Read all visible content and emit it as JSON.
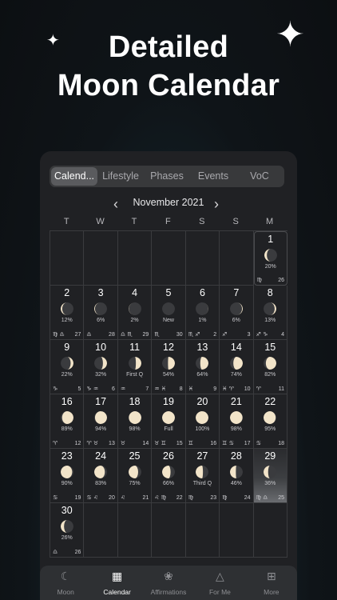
{
  "headline": {
    "line1": "Detailed",
    "line2": "Moon Calendar"
  },
  "colors": {
    "moon_lit": "#f2e4c9",
    "moon_dark": "#3a3b3e",
    "accent": "#ffffff"
  },
  "segments": [
    "Calend...",
    "Lifestyle",
    "Phases",
    "Events",
    "VoC"
  ],
  "active_segment": 0,
  "month_label": "November 2021",
  "weekdays": [
    "T",
    "W",
    "T",
    "F",
    "S",
    "S",
    "M"
  ],
  "leading_blanks": 6,
  "days": [
    {
      "day": "1",
      "illum": 0.2,
      "waxing": false,
      "pct": "20%",
      "sign": "♍",
      "time": "26"
    },
    {
      "day": "2",
      "illum": 0.12,
      "waxing": false,
      "pct": "12%",
      "sign": "♍ ♎",
      "time": "27"
    },
    {
      "day": "3",
      "illum": 0.06,
      "waxing": false,
      "pct": "6%",
      "sign": "♎",
      "time": "28"
    },
    {
      "day": "4",
      "illum": 0.02,
      "waxing": false,
      "pct": "2%",
      "sign": "♎ ♏",
      "time": "29"
    },
    {
      "day": "5",
      "illum": 0.0,
      "waxing": true,
      "pct": "New",
      "sign": "♏",
      "time": "30"
    },
    {
      "day": "6",
      "illum": 0.01,
      "waxing": true,
      "pct": "1%",
      "sign": "♏ ♐",
      "time": "2"
    },
    {
      "day": "7",
      "illum": 0.06,
      "waxing": true,
      "pct": "6%",
      "sign": "♐",
      "time": "3"
    },
    {
      "day": "8",
      "illum": 0.13,
      "waxing": true,
      "pct": "13%",
      "sign": "♐ ♑",
      "time": "4"
    },
    {
      "day": "9",
      "illum": 0.22,
      "waxing": true,
      "pct": "22%",
      "sign": "♑",
      "time": "5"
    },
    {
      "day": "10",
      "illum": 0.32,
      "waxing": true,
      "pct": "32%",
      "sign": "♑ ♒",
      "time": "6"
    },
    {
      "day": "11",
      "illum": 0.43,
      "waxing": true,
      "pct": "First Q",
      "sign": "♒",
      "time": "7"
    },
    {
      "day": "12",
      "illum": 0.54,
      "waxing": true,
      "pct": "54%",
      "sign": "♒ ♓",
      "time": "8"
    },
    {
      "day": "13",
      "illum": 0.64,
      "waxing": true,
      "pct": "64%",
      "sign": "♓",
      "time": "9"
    },
    {
      "day": "14",
      "illum": 0.74,
      "waxing": true,
      "pct": "74%",
      "sign": "♓ ♈",
      "time": "10"
    },
    {
      "day": "15",
      "illum": 0.82,
      "waxing": true,
      "pct": "82%",
      "sign": "♈",
      "time": "11"
    },
    {
      "day": "16",
      "illum": 0.89,
      "waxing": true,
      "pct": "89%",
      "sign": "♈",
      "time": "12"
    },
    {
      "day": "17",
      "illum": 0.94,
      "waxing": true,
      "pct": "94%",
      "sign": "♈ ♉",
      "time": "13"
    },
    {
      "day": "18",
      "illum": 0.98,
      "waxing": true,
      "pct": "98%",
      "sign": "♉",
      "time": "14"
    },
    {
      "day": "19",
      "illum": 1.0,
      "waxing": true,
      "pct": "Full",
      "sign": "♉ ♊",
      "time": "15"
    },
    {
      "day": "20",
      "illum": 1.0,
      "waxing": false,
      "pct": "100%",
      "sign": "♊",
      "time": "16"
    },
    {
      "day": "21",
      "illum": 0.98,
      "waxing": false,
      "pct": "98%",
      "sign": "♊ ♋",
      "time": "17"
    },
    {
      "day": "22",
      "illum": 0.95,
      "waxing": false,
      "pct": "95%",
      "sign": "♋",
      "time": "18"
    },
    {
      "day": "23",
      "illum": 0.9,
      "waxing": false,
      "pct": "90%",
      "sign": "♋",
      "time": "19"
    },
    {
      "day": "24",
      "illum": 0.83,
      "waxing": false,
      "pct": "83%",
      "sign": "♋ ♌",
      "time": "20"
    },
    {
      "day": "25",
      "illum": 0.75,
      "waxing": false,
      "pct": "75%",
      "sign": "♌",
      "time": "21"
    },
    {
      "day": "26",
      "illum": 0.66,
      "waxing": false,
      "pct": "66%",
      "sign": "♌ ♍",
      "time": "22"
    },
    {
      "day": "27",
      "illum": 0.57,
      "waxing": false,
      "pct": "Third Q",
      "sign": "♍",
      "time": "23"
    },
    {
      "day": "28",
      "illum": 0.46,
      "waxing": false,
      "pct": "46%",
      "sign": "♍",
      "time": "24"
    },
    {
      "day": "29",
      "illum": 0.36,
      "waxing": false,
      "pct": "36%",
      "sign": "♍ ♎",
      "time": "25",
      "today": true
    },
    {
      "day": "30",
      "illum": 0.26,
      "waxing": false,
      "pct": "26%",
      "sign": "♎",
      "time": "26"
    }
  ],
  "tabs": [
    {
      "label": "Moon",
      "icon": "crescent-moon-icon",
      "glyph": "☾"
    },
    {
      "label": "Calendar",
      "icon": "calendar-icon",
      "glyph": "▦"
    },
    {
      "label": "Affirmations",
      "icon": "lotus-icon",
      "glyph": "❀"
    },
    {
      "label": "For Me",
      "icon": "triquetra-icon",
      "glyph": "△"
    },
    {
      "label": "More",
      "icon": "grid-icon",
      "glyph": "⊞"
    }
  ],
  "active_tab": 1
}
